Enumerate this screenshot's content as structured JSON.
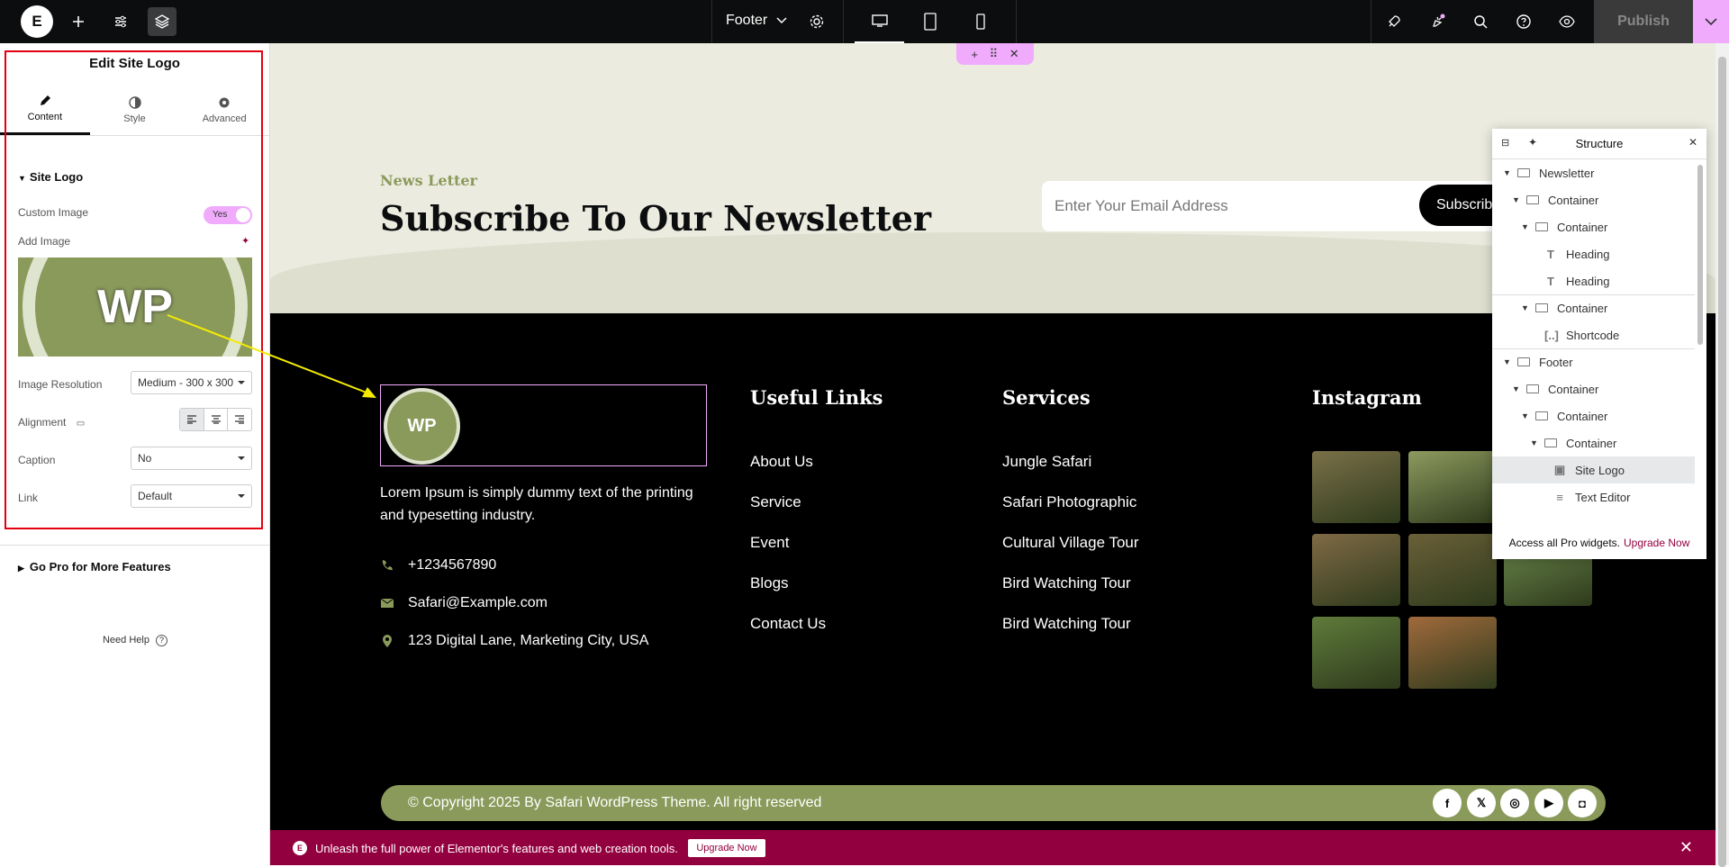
{
  "topbar": {
    "document_name": "Footer",
    "publish_label": "Publish"
  },
  "panel": {
    "title": "Edit Site Logo",
    "tabs": [
      {
        "label": "Content"
      },
      {
        "label": "Style"
      },
      {
        "label": "Advanced"
      }
    ],
    "section_title": "Site Logo",
    "custom_image_label": "Custom Image",
    "custom_image_value": "Yes",
    "add_image_label": "Add Image",
    "image_preview_text": "WP",
    "image_resolution_label": "Image Resolution",
    "image_resolution_value": "Medium - 300 x 300",
    "alignment_label": "Alignment",
    "caption_label": "Caption",
    "caption_value": "No",
    "link_label": "Link",
    "link_value": "Default",
    "go_pro_label": "Go Pro for More Features",
    "need_help_label": "Need Help"
  },
  "newsletter": {
    "subtitle": "News Letter",
    "title": "Subscribe To Our Newsletter",
    "email_placeholder": "Enter Your Email Address",
    "subscribe_label": "Subscribe"
  },
  "footer": {
    "logo_text": "WP",
    "description": "Lorem Ipsum is simply dummy text of the printing and typesetting industry.",
    "phone": "+1234567890",
    "email": "Safari@Example.com",
    "address": "123 Digital Lane, Marketing City, USA",
    "useful_links_title": "Useful Links",
    "useful_links": [
      "About Us",
      "Service",
      "Event",
      "Blogs",
      "Contact Us"
    ],
    "services_title": "Services",
    "services": [
      "Jungle Safari",
      "Safari Photographic",
      "Cultural Village Tour",
      "Bird Watching Tour",
      "Bird Watching Tour"
    ],
    "instagram_title": "Instagram",
    "instagram_colors": [
      "#7a7048",
      "#8d9a5e",
      "#6f7e63",
      "#7f6a45",
      "#6a6038",
      "#6e8c4e",
      "#5f7b3b",
      "#a06a3c"
    ],
    "copyright": "© Copyright 2025 By Safari WordPress Theme. All right reserved",
    "social_icons": [
      "facebook-icon",
      "x-icon",
      "dribbble-icon",
      "youtube-icon",
      "instagram-icon"
    ]
  },
  "promo": {
    "text": "Unleash the full power of Elementor's features and web creation tools.",
    "button_label": "Upgrade Now"
  },
  "structure": {
    "title": "Structure",
    "items": [
      {
        "label": "Newsletter",
        "level": 0,
        "caret": true,
        "icon": "container"
      },
      {
        "label": "Container",
        "level": 1,
        "caret": true,
        "icon": "container"
      },
      {
        "label": "Container",
        "level": 2,
        "caret": true,
        "icon": "container"
      },
      {
        "label": "Heading",
        "level": 3,
        "caret": false,
        "icon": "heading"
      },
      {
        "label": "Heading",
        "level": 3,
        "caret": false,
        "icon": "heading"
      },
      {
        "label": "Container",
        "level": 2,
        "caret": true,
        "icon": "container"
      },
      {
        "label": "Shortcode",
        "level": 3,
        "caret": false,
        "icon": "shortcode"
      },
      {
        "label": "Footer",
        "level": 0,
        "caret": true,
        "icon": "container"
      },
      {
        "label": "Container",
        "level": 1,
        "caret": true,
        "icon": "container"
      },
      {
        "label": "Container",
        "level": 2,
        "caret": true,
        "icon": "container"
      },
      {
        "label": "Container",
        "level": 3,
        "caret": true,
        "icon": "container"
      },
      {
        "label": "Site Logo",
        "level": 4,
        "caret": false,
        "icon": "image",
        "selected": true
      },
      {
        "label": "Text Editor",
        "level": 4,
        "caret": false,
        "icon": "text"
      }
    ],
    "footer_text": "Access all Pro widgets.",
    "footer_link": "Upgrade Now"
  },
  "colors": {
    "accent_pink": "#f0abfc",
    "olive": "#8a9a5b",
    "promo_red": "#93003f",
    "highlight_red": "#e4000f"
  }
}
